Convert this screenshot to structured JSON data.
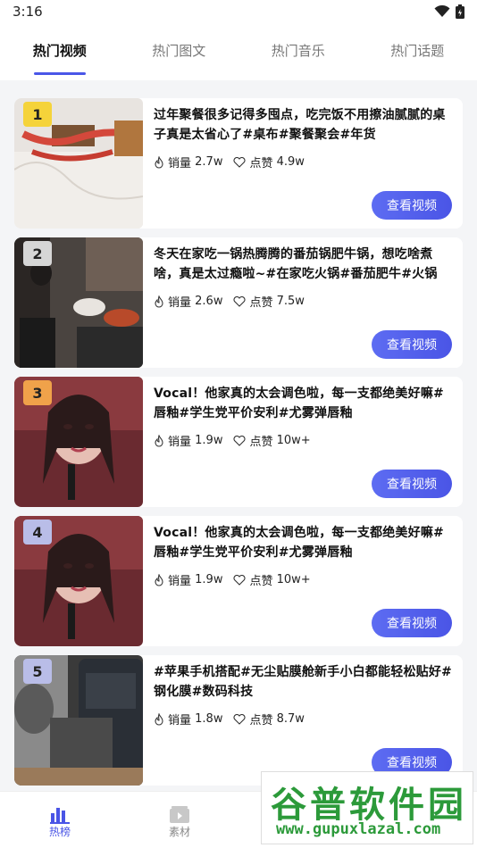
{
  "status": {
    "time": "3:16"
  },
  "tabs": [
    {
      "label": "热门视频",
      "active": true
    },
    {
      "label": "热门图文",
      "active": false
    },
    {
      "label": "热门音乐",
      "active": false
    },
    {
      "label": "热门话题",
      "active": false
    }
  ],
  "items": [
    {
      "rank": "1",
      "title": "过年聚餐很多记得多囤点，吃完饭不用擦油腻腻的桌子真是太省心了#桌布#聚餐聚会#年货",
      "sales_label": "销量",
      "sales": "2.7w",
      "likes_label": "点赞",
      "likes": "4.9w",
      "button": "查看视频"
    },
    {
      "rank": "2",
      "title": "冬天在家吃一锅热腾腾的番茄锅肥牛锅，想吃啥煮啥，真是太过瘾啦~#在家吃火锅#番茄肥牛#火锅",
      "sales_label": "销量",
      "sales": "2.6w",
      "likes_label": "点赞",
      "likes": "7.5w",
      "button": "查看视频"
    },
    {
      "rank": "3",
      "title": "Vocal！他家真的太会调色啦，每一支都绝美好嘛#唇釉#学生党平价安利#尤雾弹唇釉",
      "sales_label": "销量",
      "sales": "1.9w",
      "likes_label": "点赞",
      "likes": "10w+",
      "button": "查看视频"
    },
    {
      "rank": "4",
      "title": "Vocal！他家真的太会调色啦，每一支都绝美好嘛#唇釉#学生党平价安利#尤雾弹唇釉",
      "sales_label": "销量",
      "sales": "1.9w",
      "likes_label": "点赞",
      "likes": "10w+",
      "button": "查看视频"
    },
    {
      "rank": "5",
      "title": "#苹果手机搭配#无尘贴膜舱新手小白都能轻松贴好#钢化膜#数码科技",
      "sales_label": "销量",
      "sales": "1.8w",
      "likes_label": "点赞",
      "likes": "8.7w",
      "button": "查看视频"
    }
  ],
  "bottom_nav": [
    {
      "label": "热榜",
      "active": true
    },
    {
      "label": "素材",
      "active": false
    }
  ],
  "watermark": {
    "title": "谷普软件园",
    "url": "www.gupuxlazal.com"
  },
  "colors": {
    "accent": "#4a55e6",
    "rank1": "#f5d33a",
    "rank2": "#d6d6d6",
    "rank3": "#f0a24a",
    "rank4": "#b9bde8",
    "rank5": "#b9bde8"
  }
}
